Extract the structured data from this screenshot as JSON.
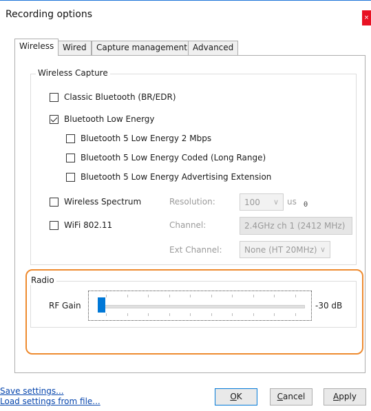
{
  "window": {
    "title": "Recording options",
    "close_glyph": "×"
  },
  "tabs": [
    "Wireless",
    "Wired",
    "Capture management",
    "Advanced"
  ],
  "wireless_capture": {
    "group_title": "Wireless Capture",
    "classic_bt": {
      "label": "Classic Bluetooth (BR/EDR)",
      "checked": false
    },
    "ble": {
      "label": "Bluetooth Low Energy",
      "checked": true
    },
    "ble_2m": {
      "label": "Bluetooth 5 Low Energy 2 Mbps",
      "checked": false
    },
    "ble_coded": {
      "label": "Bluetooth 5 Low Energy Coded (Long Range)",
      "checked": false
    },
    "ble_adv": {
      "label": "Bluetooth 5 Low Energy Advertising Extension",
      "checked": false
    },
    "spectrum": {
      "label": "Wireless Spectrum",
      "checked": false
    },
    "wifi": {
      "label": "WiFi 802.11",
      "checked": false
    },
    "resolution": {
      "label": "Resolution:",
      "value": "100",
      "unit": "us",
      "unit_suffix": "θ"
    },
    "channel": {
      "label": "Channel:",
      "value": "2.4GHz ch 1 (2412 MHz)"
    },
    "ext_channel": {
      "label": "Ext Channel:",
      "value": "None (HT 20MHz)"
    }
  },
  "radio": {
    "group_title": "Radio",
    "rf_gain_label": "RF Gain",
    "rf_gain_value": "-30 dB",
    "slider_fraction": 0.0,
    "tick_count": 10
  },
  "footer": {
    "save_link": "Save settings...",
    "load_link": "Load settings from file...",
    "ok": {
      "mnemonic": "O",
      "rest": "K"
    },
    "cancel": {
      "mnemonic": "C",
      "rest": "ancel"
    },
    "apply": {
      "mnemonic": "A",
      "rest": "pply"
    }
  },
  "colors": {
    "accent": "#0078d7",
    "highlight": "#ee8a2e",
    "close": "#e81123"
  }
}
